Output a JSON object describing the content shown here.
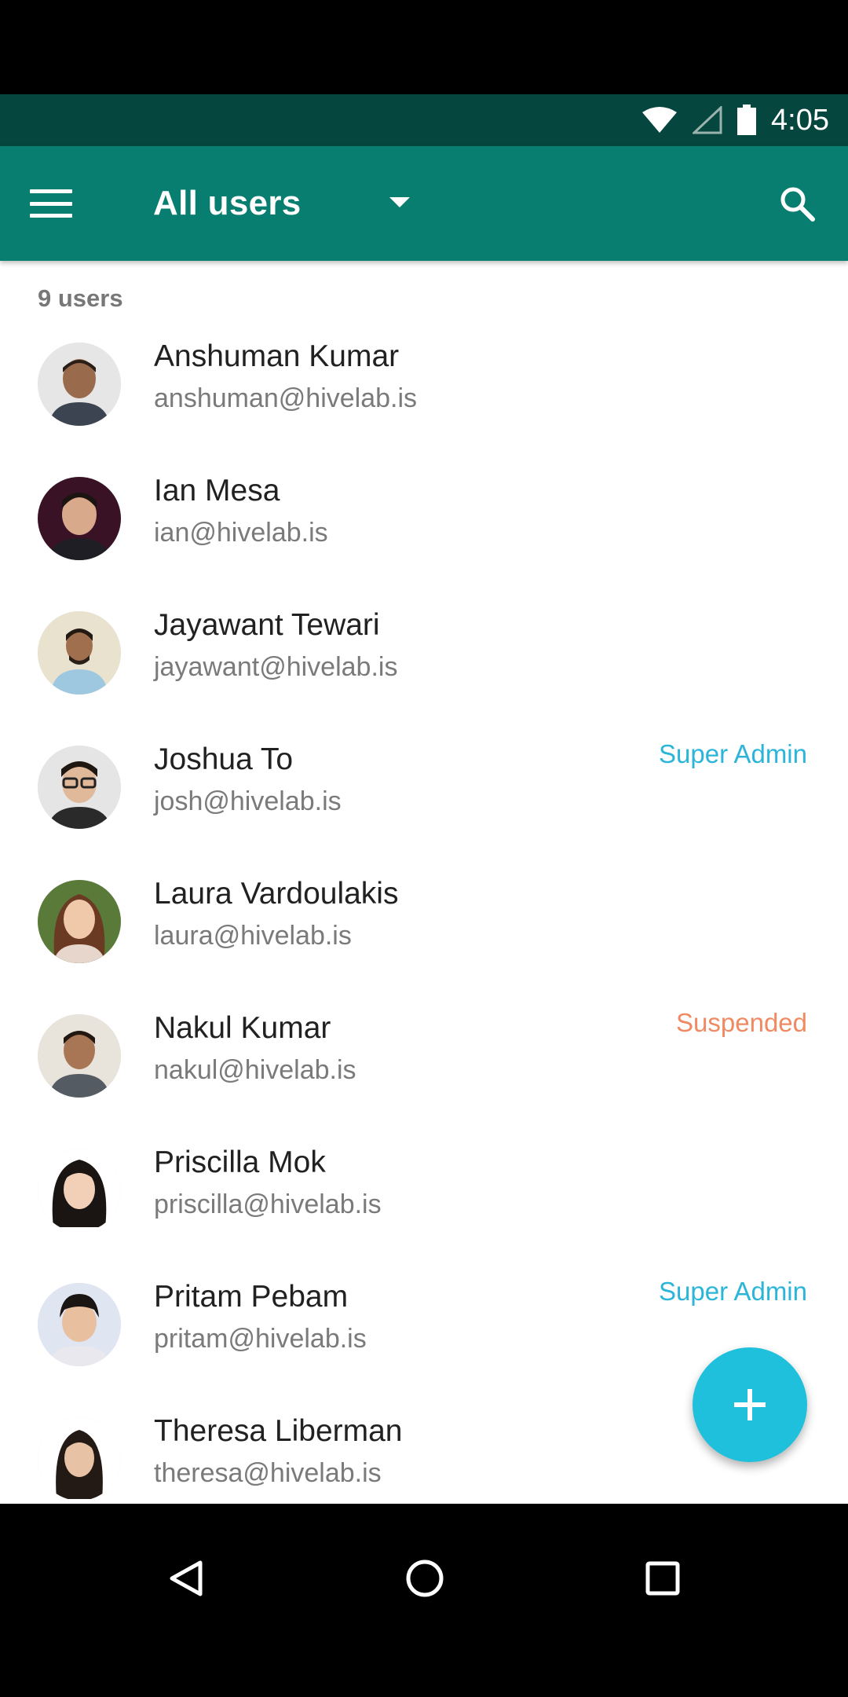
{
  "status_bar": {
    "time": "4:05"
  },
  "app_bar": {
    "title": "All users"
  },
  "user_count": "9 users",
  "users": [
    {
      "name": "Anshuman Kumar",
      "email": "anshuman@hivelab.is",
      "badge": ""
    },
    {
      "name": "Ian Mesa",
      "email": "ian@hivelab.is",
      "badge": ""
    },
    {
      "name": "Jayawant Tewari",
      "email": "jayawant@hivelab.is",
      "badge": ""
    },
    {
      "name": "Joshua To",
      "email": "josh@hivelab.is",
      "badge": "Super Admin"
    },
    {
      "name": "Laura Vardoulakis",
      "email": "laura@hivelab.is",
      "badge": ""
    },
    {
      "name": "Nakul Kumar",
      "email": "nakul@hivelab.is",
      "badge": "Suspended"
    },
    {
      "name": "Priscilla Mok",
      "email": "priscilla@hivelab.is",
      "badge": ""
    },
    {
      "name": "Pritam Pebam",
      "email": "pritam@hivelab.is",
      "badge": "Super Admin"
    },
    {
      "name": "Theresa Liberman",
      "email": "theresa@hivelab.is",
      "badge": ""
    }
  ],
  "colors": {
    "status_bar": "#05463f",
    "app_bar": "#087e70",
    "super_admin": "#2bb5d8",
    "suspended": "#ef8a62",
    "fab": "#1fc0dc"
  },
  "icons": {
    "menu": "hamburger-menu-icon",
    "dropdown": "caret-down-icon",
    "search": "search-icon",
    "fab": "plus-icon",
    "nav_back": "triangle-back-icon",
    "nav_home": "circle-home-icon",
    "nav_recents": "square-recents-icon"
  }
}
